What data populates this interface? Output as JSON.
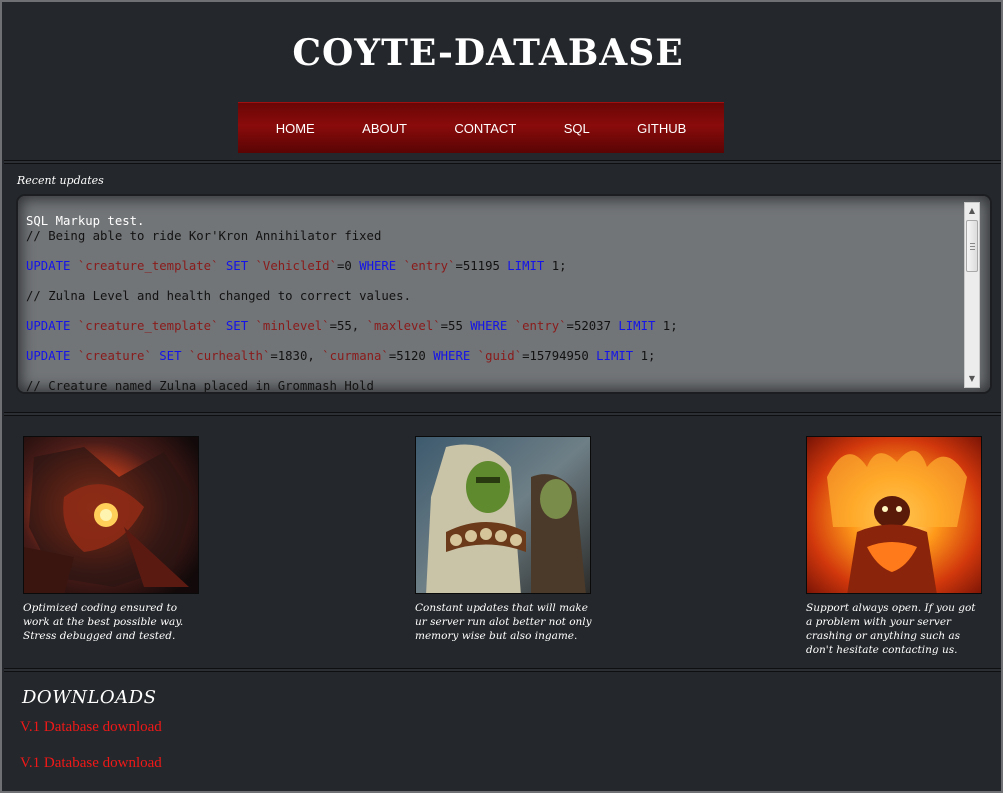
{
  "header": {
    "title": "COYTE-DATABASE"
  },
  "nav": {
    "items": [
      {
        "label": "HOME"
      },
      {
        "label": "ABOUT"
      },
      {
        "label": "CONTACT"
      },
      {
        "label": "SQL"
      },
      {
        "label": "GITHUB"
      }
    ]
  },
  "recent_updates": {
    "label": "Recent updates",
    "code_lines": [
      [
        {
          "t": "SQL Markup test.",
          "c": "plain-white"
        }
      ],
      [
        {
          "t": "// Being able to ride Kor'Kron Annihilator fixed",
          "c": "plain"
        }
      ],
      [],
      [
        {
          "t": "UPDATE",
          "c": "kw"
        },
        {
          "t": " ",
          "c": "plain"
        },
        {
          "t": "`creature_template`",
          "c": "tb"
        },
        {
          "t": " ",
          "c": "plain"
        },
        {
          "t": "SET",
          "c": "kw"
        },
        {
          "t": " ",
          "c": "plain"
        },
        {
          "t": "`VehicleId`",
          "c": "tb"
        },
        {
          "t": "=0 ",
          "c": "plain"
        },
        {
          "t": "WHERE",
          "c": "kw"
        },
        {
          "t": " ",
          "c": "plain"
        },
        {
          "t": "`entry`",
          "c": "tb"
        },
        {
          "t": "=51195 ",
          "c": "plain"
        },
        {
          "t": "LIMIT",
          "c": "kw"
        },
        {
          "t": " 1;",
          "c": "plain"
        }
      ],
      [],
      [
        {
          "t": "// Zulna Level and health changed to correct values.",
          "c": "plain"
        }
      ],
      [],
      [
        {
          "t": "UPDATE",
          "c": "kw"
        },
        {
          "t": " ",
          "c": "plain"
        },
        {
          "t": "`creature_template`",
          "c": "tb"
        },
        {
          "t": " ",
          "c": "plain"
        },
        {
          "t": "SET",
          "c": "kw"
        },
        {
          "t": " ",
          "c": "plain"
        },
        {
          "t": "`minlevel`",
          "c": "tb"
        },
        {
          "t": "=55, ",
          "c": "plain"
        },
        {
          "t": "`maxlevel`",
          "c": "tb"
        },
        {
          "t": "=55 ",
          "c": "plain"
        },
        {
          "t": "WHERE",
          "c": "kw"
        },
        {
          "t": " ",
          "c": "plain"
        },
        {
          "t": "`entry`",
          "c": "tb"
        },
        {
          "t": "=52037 ",
          "c": "plain"
        },
        {
          "t": "LIMIT",
          "c": "kw"
        },
        {
          "t": " 1;",
          "c": "plain"
        }
      ],
      [],
      [
        {
          "t": "UPDATE",
          "c": "kw"
        },
        {
          "t": " ",
          "c": "plain"
        },
        {
          "t": "`creature`",
          "c": "tb"
        },
        {
          "t": " ",
          "c": "plain"
        },
        {
          "t": "SET",
          "c": "kw"
        },
        {
          "t": " ",
          "c": "plain"
        },
        {
          "t": "`curhealth`",
          "c": "tb"
        },
        {
          "t": "=1830, ",
          "c": "plain"
        },
        {
          "t": "`curmana`",
          "c": "tb"
        },
        {
          "t": "=5120 ",
          "c": "plain"
        },
        {
          "t": "WHERE",
          "c": "kw"
        },
        {
          "t": " ",
          "c": "plain"
        },
        {
          "t": "`guid`",
          "c": "tb"
        },
        {
          "t": "=15794950 ",
          "c": "plain"
        },
        {
          "t": "LIMIT",
          "c": "kw"
        },
        {
          "t": " 1;",
          "c": "plain"
        }
      ],
      [],
      [
        {
          "t": "// Creature named Zulna placed in Grommash Hold",
          "c": "plain"
        }
      ]
    ]
  },
  "features": [
    {
      "image": "deathwing-dragon-image",
      "text": "Optimized coding ensured to work at the best possible way. Stress debugged and tested."
    },
    {
      "image": "orc-characters-image",
      "text": "Constant updates that will make ur server run alot better not only memory wise but also ingame."
    },
    {
      "image": "fire-elemental-image",
      "text": "Support always open. If you got a problem with your server crashing or anything such as don't hesitate contacting us."
    }
  ],
  "downloads": {
    "title": "DOWNLOADS",
    "links": [
      {
        "label": "V.1 Database download"
      },
      {
        "label": "V.1 Database download"
      }
    ]
  },
  "colors": {
    "background": "#23262a",
    "nav": "#8a0b0b",
    "link": "#f01818",
    "sql_keyword": "#1414e8",
    "sql_identifier": "#8a1a1a"
  }
}
